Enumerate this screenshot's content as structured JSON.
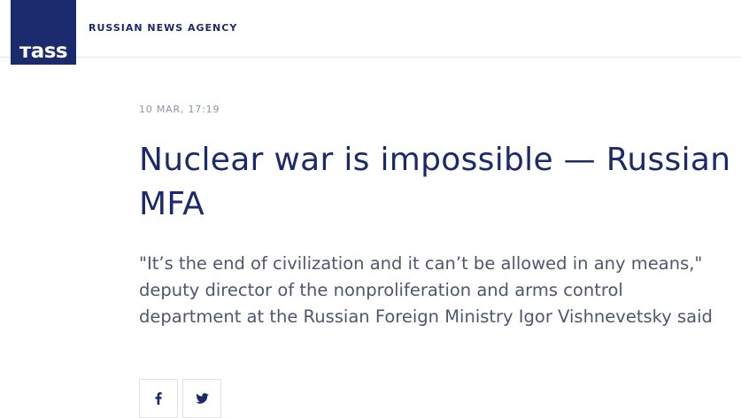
{
  "header": {
    "logo_text": "тass",
    "agency_name": "RUSSIAN NEWS AGENCY"
  },
  "article": {
    "dateline": "10 MAR, 17:19",
    "title": "Nuclear war is impossible — Russian MFA",
    "lead": "\"It’s the end of civilization and it can’t be allowed in any means,\" deputy director of the nonproliferation and arms control department at the Russian Foreign Ministry Igor Vishnevetsky said"
  },
  "share": {
    "buttons": [
      {
        "icon": "facebook-icon"
      },
      {
        "icon": "twitter-icon"
      }
    ]
  },
  "colors": {
    "brand": "#1a2a6c",
    "dateline": "#8c94a8",
    "lead": "#4d5770",
    "border": "#dfe2e8"
  }
}
